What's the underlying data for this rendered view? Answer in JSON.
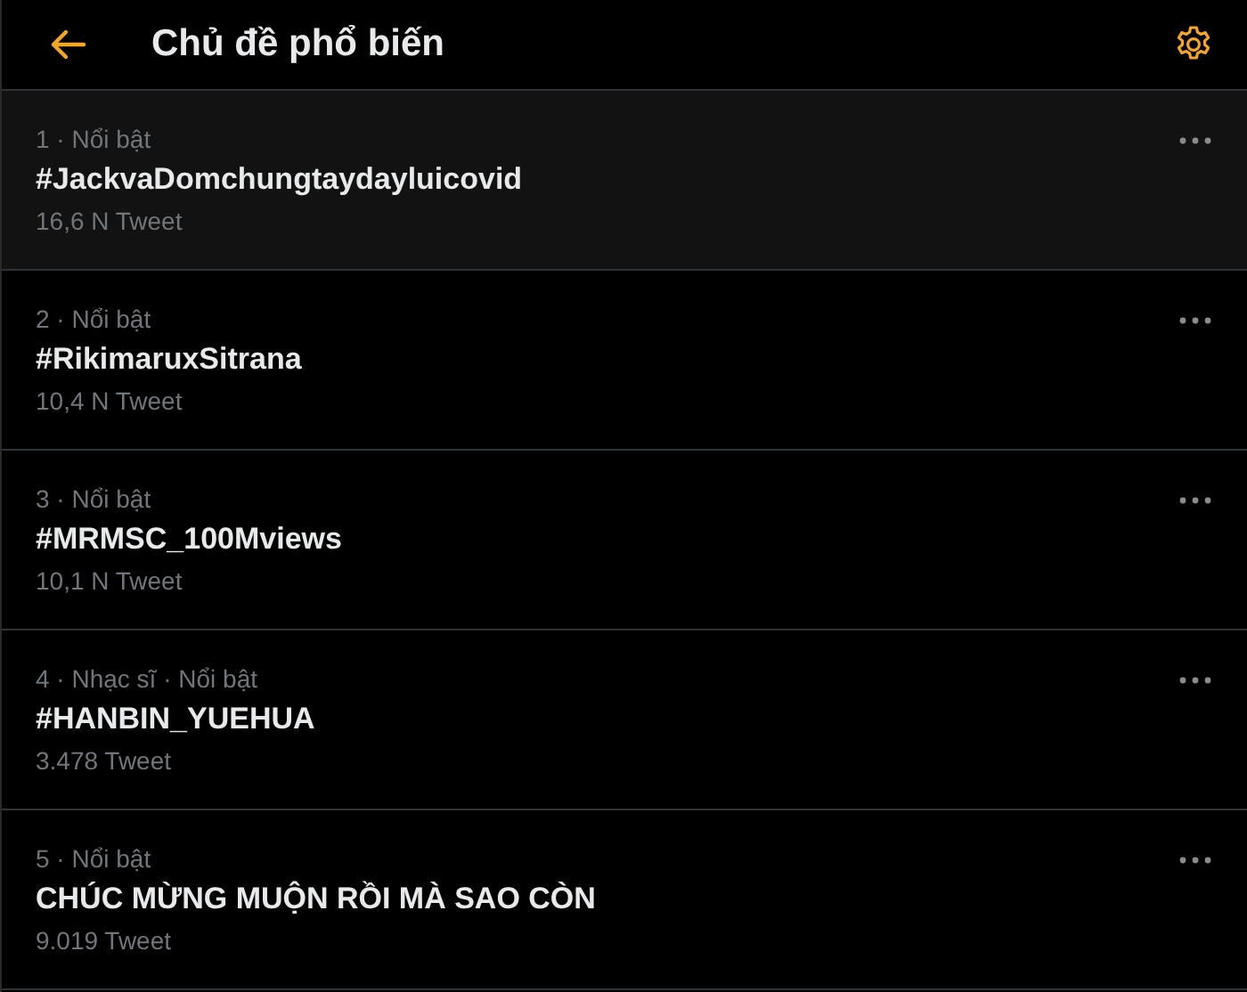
{
  "header": {
    "title": "Chủ đề phổ biến"
  },
  "trends": [
    {
      "meta": "1 · Nổi bật",
      "name": "#JackvaDomchungtaydayluicovid",
      "count": "16,6 N Tweet",
      "hovered": true
    },
    {
      "meta": "2 · Nổi bật",
      "name": "#RikimaruxSitrana",
      "count": "10,4 N Tweet",
      "hovered": false
    },
    {
      "meta": "3 · Nổi bật",
      "name": "#MRMSC_100Mviews",
      "count": "10,1 N Tweet",
      "hovered": false
    },
    {
      "meta": "4 · Nhạc sĩ · Nổi bật",
      "name": "#HANBIN_YUEHUA",
      "count": "3.478 Tweet",
      "hovered": false
    },
    {
      "meta": "5 · Nổi bật",
      "name": "CHÚC MỪNG MUỘN RỒI MÀ SAO CÒN",
      "count": "9.019 Tweet",
      "hovered": false
    }
  ]
}
